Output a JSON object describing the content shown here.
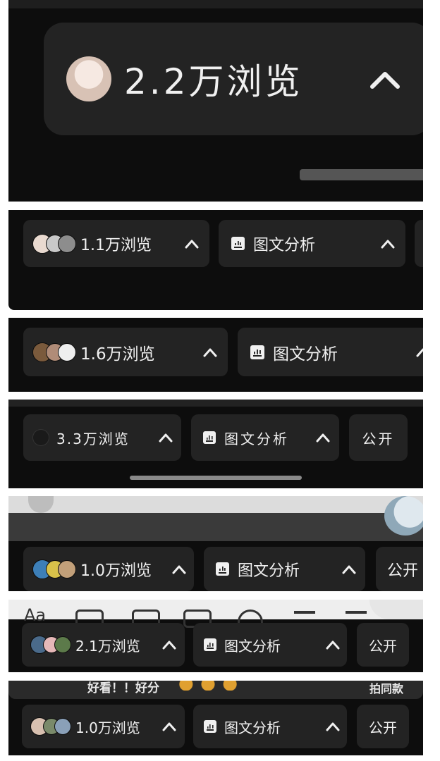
{
  "panels": [
    {
      "views": "2.2万浏览"
    },
    {
      "views": "1.1万浏览",
      "analysis": "图文分析"
    },
    {
      "views": "1.6万浏览",
      "analysis": "图文分析"
    },
    {
      "views": "3.3万浏览",
      "analysis": "图文分析",
      "visibility": "公开"
    },
    {
      "views": "1.0万浏览",
      "analysis": "图文分析",
      "visibility": "公开"
    },
    {
      "views": "2.1万浏览",
      "analysis": "图文分析",
      "visibility": "公开",
      "toolbar_text": "Aa"
    },
    {
      "views": "1.0万浏览",
      "analysis": "图文分析",
      "visibility": "公开",
      "comment_text": "好看！！好分",
      "same_style": "拍同款"
    }
  ],
  "icons": {
    "chevron": "chevron-up-icon",
    "analysis": "bar-chart-icon",
    "viewer": "avatar-icon"
  },
  "colors": {
    "panel_bg": "#0d0d0d",
    "chip_bg": "#232323",
    "text": "#f0f0f0"
  }
}
